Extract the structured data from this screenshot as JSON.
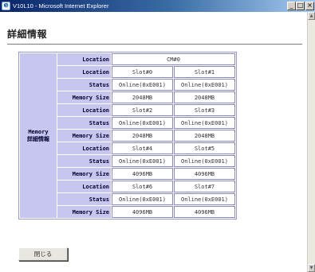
{
  "window": {
    "title": "V10L10 - Microsoft Internet Explorer",
    "min_glyph": "_",
    "max_glyph": "□",
    "close_glyph": "×",
    "app_icon_glyph": "e"
  },
  "page": {
    "heading": "詳細情報",
    "close_button_label": "閉じる"
  },
  "memory_info": {
    "group_label_line1": "Memory",
    "group_label_line2": "詳細情報",
    "location_header": "Location",
    "location_value": "CM#0",
    "row_labels": {
      "location": "Location",
      "status": "Status",
      "memory_size": "Memory Size"
    },
    "slot_pairs": [
      {
        "slot_left": "Slot#0",
        "slot_right": "Slot#1",
        "status_left": "Online(0xE001)",
        "status_right": "Online(0xE001)",
        "size_left": "2048MB",
        "size_right": "2048MB"
      },
      {
        "slot_left": "Slot#2",
        "slot_right": "Slot#3",
        "status_left": "Online(0xE001)",
        "status_right": "Online(0xE001)",
        "size_left": "2048MB",
        "size_right": "2048MB"
      },
      {
        "slot_left": "Slot#4",
        "slot_right": "Slot#5",
        "status_left": "Online(0xE001)",
        "status_right": "Online(0xE001)",
        "size_left": "4096MB",
        "size_right": "4096MB"
      },
      {
        "slot_left": "Slot#6",
        "slot_right": "Slot#7",
        "status_left": "Online(0xE001)",
        "status_right": "Online(0xE001)",
        "size_left": "4096MB",
        "size_right": "4096MB"
      }
    ]
  },
  "colors": {
    "header_cell": "#c6c6ee",
    "titlebar_start": "#0a246a",
    "titlebar_end": "#a6caf0"
  }
}
